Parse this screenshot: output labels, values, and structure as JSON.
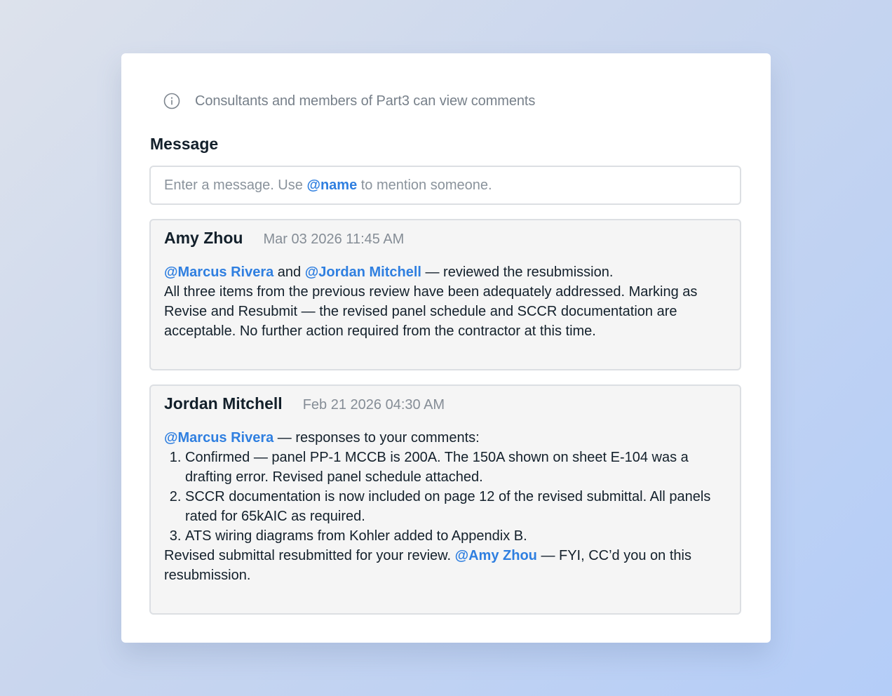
{
  "notice": {
    "icon": "info-icon",
    "text": "Consultants and members of Part3 can view comments"
  },
  "message": {
    "label": "Message",
    "placeholder_before": "Enter a message. Use ",
    "placeholder_mention": "@name",
    "placeholder_after": " to mention someone."
  },
  "colors": {
    "mention": "#2f7fe0",
    "muted": "#77808a",
    "comment_bg": "#f5f5f5"
  },
  "comments": [
    {
      "author": "Amy Zhou",
      "timestamp": "Mar 03 2026 11:45 AM",
      "mention_1": "@Marcus Rivera",
      "connector": " and ",
      "mention_2": "@Jordan Mitchell",
      "line_1_rest": " — reviewed the resubmission.",
      "paragraph": "All three items from the previous review have been adequately addressed. Marking as Revise and Resubmit — the revised panel schedule and SCCR documentation are acceptable. No further action required from the contractor at this time."
    },
    {
      "author": "Jordan Mitchell",
      "timestamp": "Feb 21 2026 04:30 AM",
      "mention_1": "@Marcus Rivera",
      "line_1_rest": " — responses to your comments:",
      "items": [
        "Confirmed — panel PP-1 MCCB is 200A. The 150A shown on sheet E-104 was a drafting error. Revised panel schedule attached.",
        "SCCR documentation is now included on page 12 of the revised submittal. All panels rated for 65kAIC as required.",
        "ATS wiring diagrams from Kohler added to Appendix B."
      ],
      "closing_before": "Revised submittal resubmitted for your review. ",
      "closing_mention": "@Amy Zhou",
      "closing_after": " — FYI, CC’d you on this resubmission."
    }
  ]
}
